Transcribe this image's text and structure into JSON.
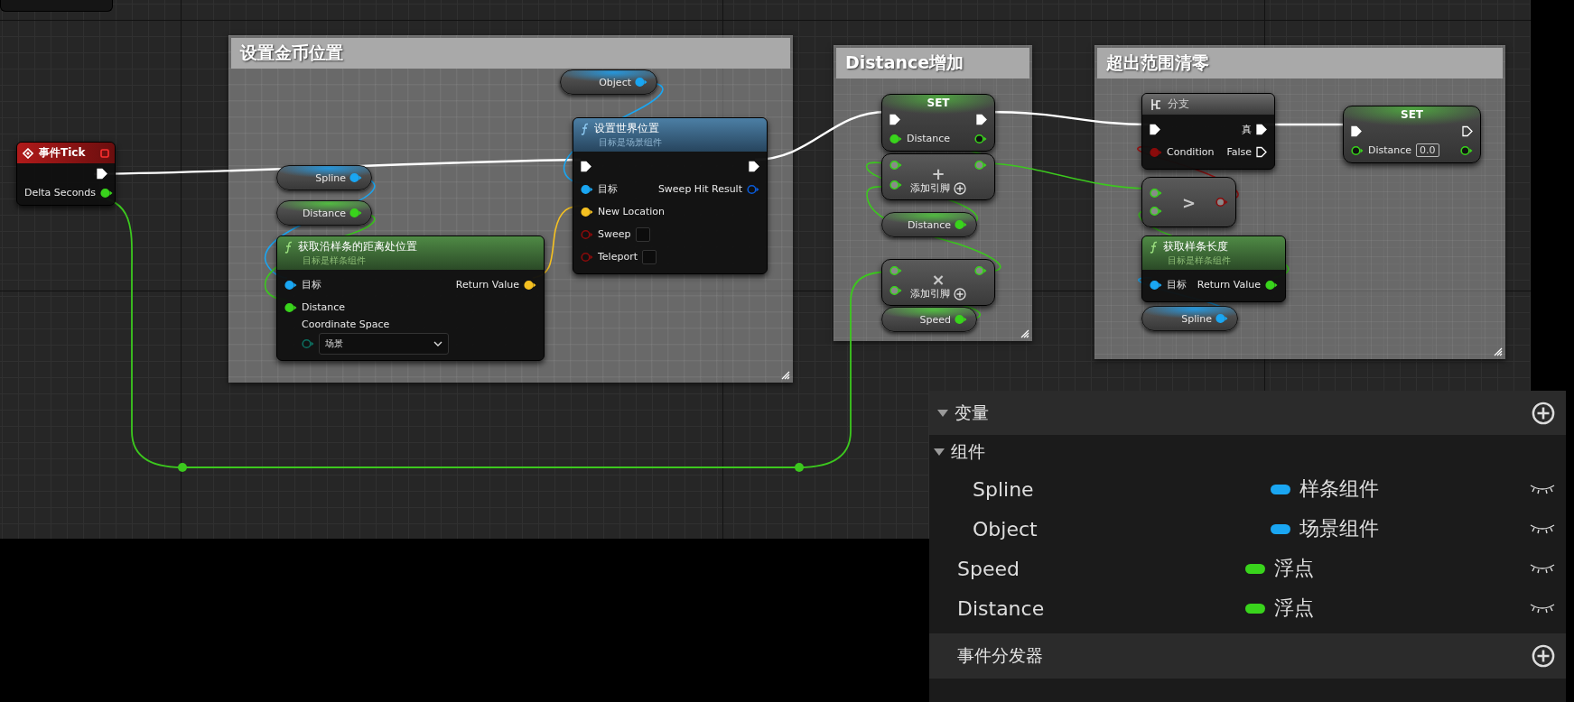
{
  "comments": [
    {
      "title": "设置金币位置"
    },
    {
      "title": "Distance增加"
    },
    {
      "title": "超出范围清零"
    }
  ],
  "nodes": [
    {
      "kind": "event",
      "title": "事件Tick",
      "outputs": [
        {
          "kind": "exec",
          "connected": true
        },
        {
          "label": "Delta Seconds",
          "kind": "float",
          "connected": true
        }
      ]
    },
    {
      "kind": "getter",
      "label": "Spline",
      "pin": {
        "kind": "object",
        "connected": true
      }
    },
    {
      "kind": "getter",
      "label": "Distance",
      "pin": {
        "kind": "float",
        "connected": true
      }
    },
    {
      "kind": "function",
      "title": "获取沿样条的距离处位置",
      "subtitle": "目标是样条组件",
      "pure": true,
      "inputs": [
        {
          "label": "目标",
          "kind": "object",
          "connected": true
        },
        {
          "label": "Distance",
          "kind": "float",
          "connected": true
        },
        {
          "label": "Coordinate Space",
          "kind": "enum",
          "connected": false,
          "value": "场景"
        }
      ],
      "outputs": [
        {
          "label": "Return Value",
          "kind": "vector",
          "connected": true
        }
      ]
    },
    {
      "kind": "getter",
      "label": "Object",
      "pin": {
        "kind": "object",
        "connected": true
      }
    },
    {
      "kind": "function",
      "title": "设置世界位置",
      "subtitle": "目标是场景组件",
      "pure": false,
      "inputs": [
        {
          "kind": "exec",
          "connected": true
        },
        {
          "label": "目标",
          "kind": "object",
          "connected": true
        },
        {
          "label": "New Location",
          "kind": "vector",
          "connected": true
        },
        {
          "label": "Sweep",
          "kind": "bool",
          "connected": false,
          "checked": false
        },
        {
          "label": "Teleport",
          "kind": "bool",
          "connected": false,
          "checked": false
        }
      ],
      "outputs": [
        {
          "kind": "exec",
          "connected": true
        },
        {
          "label": "Sweep Hit Result",
          "kind": "struct",
          "connected": false
        }
      ]
    },
    {
      "kind": "set",
      "title": "SET",
      "inputs": [
        {
          "kind": "exec",
          "connected": true
        },
        {
          "label": "Distance",
          "kind": "float",
          "connected": true
        }
      ],
      "outputs": [
        {
          "kind": "exec",
          "connected": true
        },
        {
          "kind": "float",
          "connected": false
        }
      ]
    },
    {
      "kind": "math",
      "operator": "+",
      "add_pin": "添加引脚",
      "inputs": [
        {
          "kind": "float"
        },
        {
          "kind": "float"
        }
      ],
      "outputs": [
        {
          "kind": "float"
        }
      ]
    },
    {
      "kind": "getter",
      "label": "Distance",
      "pin": {
        "kind": "float",
        "connected": true
      }
    },
    {
      "kind": "math",
      "operator": "×",
      "add_pin": "添加引脚",
      "inputs": [
        {
          "kind": "float"
        },
        {
          "kind": "float"
        }
      ],
      "outputs": [
        {
          "kind": "float"
        }
      ]
    },
    {
      "kind": "getter",
      "label": "Speed",
      "pin": {
        "kind": "float",
        "connected": true
      }
    },
    {
      "kind": "branch",
      "title": "分支",
      "inputs": [
        {
          "kind": "exec",
          "connected": true
        },
        {
          "label": "Condition",
          "kind": "bool",
          "connected": true
        }
      ],
      "outputs": [
        {
          "label": "真",
          "kind": "exec",
          "connected": true
        },
        {
          "label": "False",
          "kind": "exec",
          "connected": false
        }
      ]
    },
    {
      "kind": "compare",
      "operator": ">",
      "inputs": [
        {
          "kind": "float"
        },
        {
          "kind": "float"
        }
      ],
      "outputs": [
        {
          "kind": "bool"
        }
      ]
    },
    {
      "kind": "function",
      "title": "获取样条长度",
      "subtitle": "目标是样条组件",
      "pure": true,
      "inputs": [
        {
          "label": "目标",
          "kind": "object",
          "connected": true
        }
      ],
      "outputs": [
        {
          "label": "Return Value",
          "kind": "float",
          "connected": true
        }
      ]
    },
    {
      "kind": "getter",
      "label": "Spline",
      "pin": {
        "kind": "object",
        "connected": true
      }
    },
    {
      "kind": "set",
      "title": "SET",
      "inputs": [
        {
          "kind": "exec",
          "connected": true
        },
        {
          "label": "Distance",
          "kind": "float",
          "connected": false,
          "value": "0.0"
        }
      ],
      "outputs": [
        {
          "kind": "exec",
          "connected": false
        },
        {
          "kind": "float",
          "connected": false
        }
      ]
    }
  ],
  "my_blueprint": {
    "variables_header": {
      "title": "变量",
      "expanded": true
    },
    "groups": [
      {
        "title": "组件",
        "expanded": true,
        "items": [
          {
            "name": "Spline",
            "type": "样条组件",
            "color": "#1aa6f2"
          },
          {
            "name": "Object",
            "type": "场景组件",
            "color": "#1aa6f2"
          }
        ]
      }
    ],
    "variables": [
      {
        "name": "Speed",
        "type": "浮点",
        "color": "#39d41c"
      },
      {
        "name": "Distance",
        "type": "浮点",
        "color": "#39d41c"
      }
    ],
    "dispatchers_header": {
      "title": "事件分发器"
    }
  }
}
